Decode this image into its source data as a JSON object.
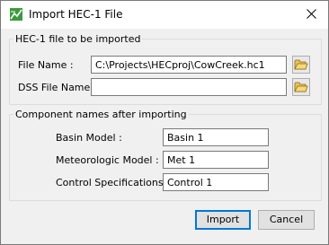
{
  "window": {
    "title": "Import HEC-1 File",
    "icon": "hec-hms-app-icon",
    "close_icon": "close-icon"
  },
  "file_group": {
    "legend": "HEC-1 file to be imported",
    "file_name": {
      "label": "File Name :",
      "value": "C:\\Projects\\HECproj\\CowCreek.hc1",
      "browse_icon": "folder-open-icon"
    },
    "dss_file_name": {
      "label": "DSS File Name :",
      "value": "",
      "browse_icon": "folder-open-icon"
    }
  },
  "component_group": {
    "legend": "Component names after importing",
    "basin_model": {
      "label": "Basin Model :",
      "value": "Basin 1"
    },
    "meteorologic_model": {
      "label": "Meteorologic Model :",
      "value": "Met 1"
    },
    "control_specifications": {
      "label": "Control Specifications :",
      "value": "Control 1"
    }
  },
  "buttons": {
    "import": "Import",
    "cancel": "Cancel"
  },
  "colors": {
    "dialog_background": "#f0f0f0",
    "title_bar": "#ffffff",
    "default_button_border": "#0078d7"
  }
}
